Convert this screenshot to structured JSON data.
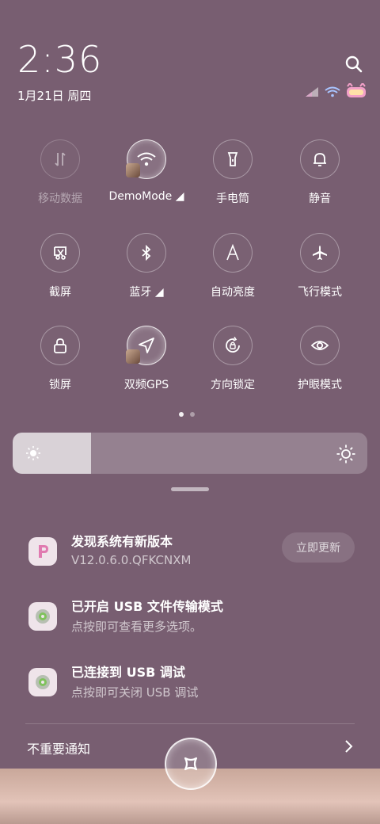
{
  "status": {
    "time": "2:36",
    "date": "1月21日 周四"
  },
  "tiles": [
    {
      "label": "移动数据",
      "icon": "mobile-data-icon"
    },
    {
      "label": "DemoMode ◢",
      "icon": "wifi-icon"
    },
    {
      "label": "手电筒",
      "icon": "flashlight-icon"
    },
    {
      "label": "静音",
      "icon": "bell-icon"
    },
    {
      "label": "截屏",
      "icon": "screenshot-icon"
    },
    {
      "label": "蓝牙 ◢",
      "icon": "bluetooth-icon"
    },
    {
      "label": "自动亮度",
      "icon": "auto-brightness-icon"
    },
    {
      "label": "飞行模式",
      "icon": "airplane-icon"
    },
    {
      "label": "锁屏",
      "icon": "lock-icon"
    },
    {
      "label": "双频GPS",
      "icon": "gps-icon"
    },
    {
      "label": "方向锁定",
      "icon": "rotation-lock-icon"
    },
    {
      "label": "护眼模式",
      "icon": "eye-icon"
    }
  ],
  "brightness": {
    "level": 0.22
  },
  "notifications": [
    {
      "title": "发现系统有新版本",
      "subtitle": "V12.0.6.0.QFKCNXM",
      "action": "立即更新"
    },
    {
      "title": "已开启 USB 文件传输模式",
      "subtitle": "点按即可查看更多选项。"
    },
    {
      "title": "已连接到 USB 调试",
      "subtitle": "点按即可关闭 USB 调试"
    }
  ],
  "minor_notifications_label": "不重要通知",
  "colors": {
    "background": "#785e71",
    "accent": "#ffffff"
  }
}
